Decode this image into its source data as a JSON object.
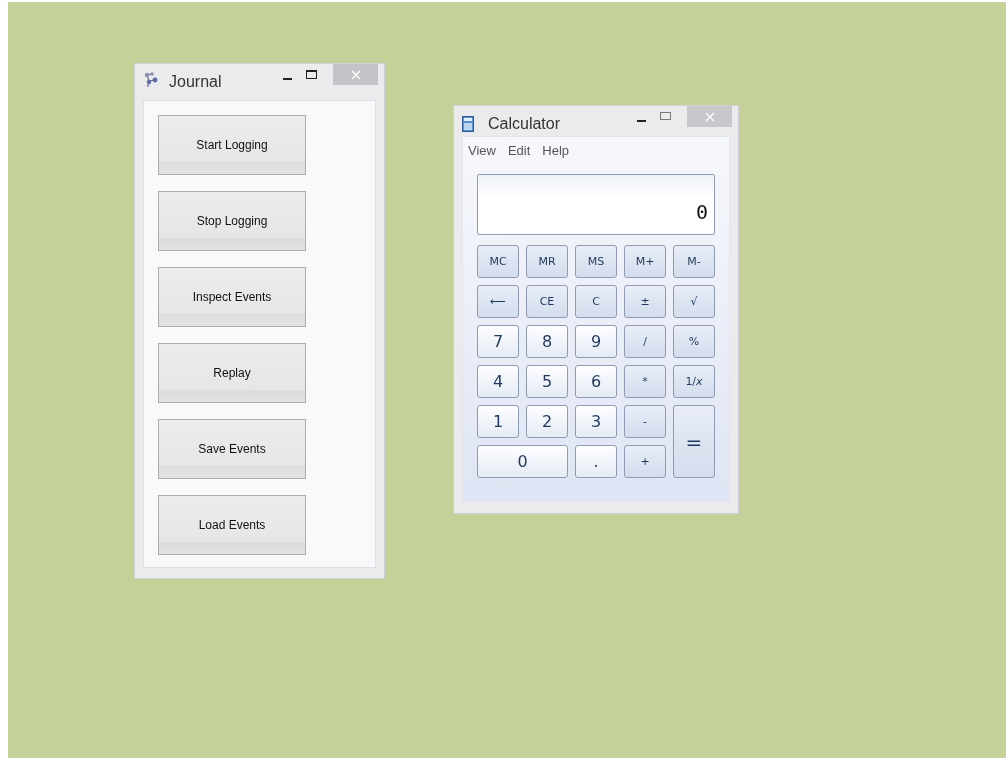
{
  "journal": {
    "title": "Journal",
    "buttons": [
      "Start Logging",
      "Stop Logging",
      "Inspect Events",
      "Replay",
      "Save Events",
      "Load Events"
    ]
  },
  "calculator": {
    "title": "Calculator",
    "menu": [
      "View",
      "Edit",
      "Help"
    ],
    "display": "0",
    "keys": [
      {
        "label": "MC",
        "kind": "function"
      },
      {
        "label": "MR",
        "kind": "function"
      },
      {
        "label": "MS",
        "kind": "function"
      },
      {
        "label": "M+",
        "kind": "function"
      },
      {
        "label": "M-",
        "kind": "function"
      },
      {
        "label": "⟵",
        "kind": "function"
      },
      {
        "label": "CE",
        "kind": "function"
      },
      {
        "label": "C",
        "kind": "function"
      },
      {
        "label": "±",
        "kind": "function"
      },
      {
        "label": "√",
        "kind": "function"
      },
      {
        "label": "7",
        "kind": "digit"
      },
      {
        "label": "8",
        "kind": "digit"
      },
      {
        "label": "9",
        "kind": "digit"
      },
      {
        "label": "/",
        "kind": "function"
      },
      {
        "label": "%",
        "kind": "function"
      },
      {
        "label": "4",
        "kind": "digit"
      },
      {
        "label": "5",
        "kind": "digit"
      },
      {
        "label": "6",
        "kind": "digit"
      },
      {
        "label": "*",
        "kind": "function"
      },
      {
        "label": "1/*x*",
        "kind": "function"
      },
      {
        "label": "1",
        "kind": "digit"
      },
      {
        "label": "2",
        "kind": "digit"
      },
      {
        "label": "3",
        "kind": "digit"
      },
      {
        "label": "-",
        "kind": "function"
      },
      {
        "label": "=",
        "kind": "equals"
      },
      {
        "label": "0",
        "kind": "zero"
      },
      {
        "label": ".",
        "kind": "digit"
      },
      {
        "label": "+",
        "kind": "function"
      }
    ]
  }
}
